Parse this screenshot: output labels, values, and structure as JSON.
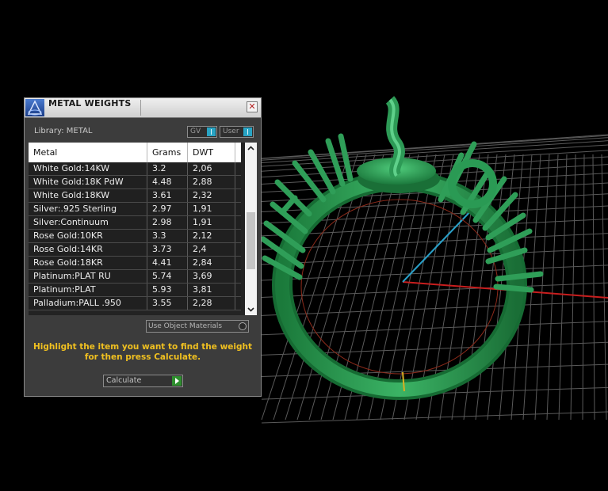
{
  "panel": {
    "title": "METAL WEIGHTS",
    "close_glyph": "✕",
    "library_label": "Library: METAL",
    "toggles": {
      "gv": "GV",
      "user": "User"
    },
    "columns": [
      "Metal",
      "Grams",
      "DWT"
    ],
    "rows": [
      [
        "White Gold:14KW",
        "3.2",
        "2,06"
      ],
      [
        "White Gold:18K PdW",
        "4.48",
        "2,88"
      ],
      [
        "White Gold:18KW",
        "3.61",
        "2,32"
      ],
      [
        "Silver:.925 Sterling",
        "2.97",
        "1,91"
      ],
      [
        "Silver:Continuum",
        "2.98",
        "1,91"
      ],
      [
        "Rose Gold:10KR",
        "3.3",
        "2,12"
      ],
      [
        "Rose Gold:14KR",
        "3.73",
        "2,4"
      ],
      [
        "Rose Gold:18KR",
        "4.41",
        "2,84"
      ],
      [
        "Platinum:PLAT RU",
        "5.74",
        "3,69"
      ],
      [
        "Platinum:PLAT",
        "5.93",
        "3,81"
      ],
      [
        "Palladium:PALL .950",
        "3.55",
        "2,28"
      ]
    ],
    "use_object_materials": "Use Object Materials",
    "hint": "Highlight the item you want to find the weight for then press Calculate.",
    "calculate_label": "Calculate",
    "icons": {
      "app": "app-logo-icon",
      "close": "close-icon",
      "scroll_up": "chevron-up-icon",
      "scroll_down": "chevron-down-icon",
      "go": "play-arrow-icon"
    }
  },
  "colors": {
    "viewport_bg": "#000000",
    "grid": "#5a5a5a",
    "ring": "#1f8a46",
    "axis_x": "#c81e1e",
    "axis_y": "#2aa0c8",
    "hint": "#f0c020",
    "toggle_on": "#28a4c4"
  }
}
